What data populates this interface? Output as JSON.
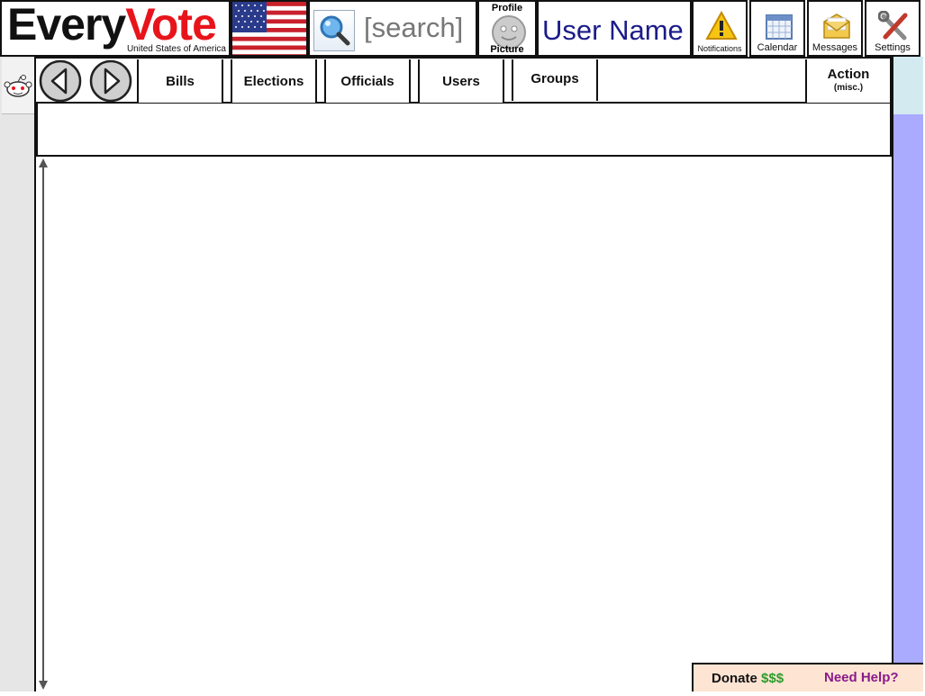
{
  "header": {
    "logo_every": "Every",
    "logo_vote": "Vote",
    "logo_subtitle": "United States of America",
    "flag_icon": "us-flag",
    "search_placeholder": "[search]",
    "search_icon": "magnifier-icon",
    "profile_top": "Profile",
    "profile_bottom": "Picture",
    "user_name": "User Name"
  },
  "toolbar": [
    {
      "label": "Notifications",
      "icon": "warning-icon"
    },
    {
      "label": "Calendar",
      "icon": "calendar-icon"
    },
    {
      "label": "Messages",
      "icon": "envelope-icon"
    },
    {
      "label": "Settings",
      "icon": "tools-icon"
    }
  ],
  "nav": {
    "back_icon": "back-arrow-icon",
    "forward_icon": "forward-arrow-icon",
    "tabs": [
      {
        "label": "Bills"
      },
      {
        "label": "Elections"
      },
      {
        "label": "Officials"
      },
      {
        "label": "Users"
      },
      {
        "label": "Groups"
      }
    ],
    "action_label": "Action",
    "action_sub": "(misc.)"
  },
  "footer": {
    "donate": "Donate",
    "donate_amount": "$$$",
    "help": "Need Help?"
  },
  "colors": {
    "brand_red": "#e8141b",
    "username_blue": "#1c1c8a",
    "right_bar": "#aaaaff",
    "footer_bg": "#fde4d3",
    "help_purple": "#8a1a8a",
    "donate_green": "#2b9e2b"
  }
}
